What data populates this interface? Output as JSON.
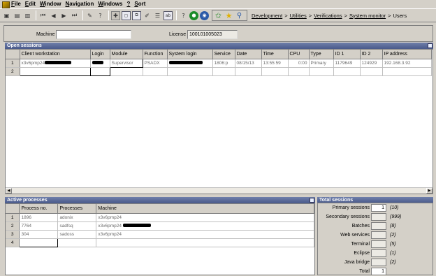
{
  "menu": {
    "items": [
      {
        "u": "F",
        "rest": "ile"
      },
      {
        "u": "E",
        "rest": "dit"
      },
      {
        "u": "W",
        "rest": "indow"
      },
      {
        "u": "N",
        "rest": "avigation"
      },
      {
        "u": "W",
        "rest": "indows"
      },
      {
        "u": "?",
        "rest": ""
      },
      {
        "u": "S",
        "rest": "ort"
      }
    ]
  },
  "breadcrumb": {
    "items": [
      "Development",
      "Utilities",
      "Verifications",
      "System monitor"
    ],
    "current": "Users",
    "separator": ">"
  },
  "filter": {
    "machine_label": "Machine",
    "machine_value": "",
    "license_label": "License",
    "license_value": "100101005023"
  },
  "open_sessions": {
    "title": "Open sessions",
    "columns": [
      "",
      "Client workstation",
      "Login",
      "Module",
      "Function",
      "System login",
      "Service",
      "Date",
      "Time",
      "CPU",
      "Type",
      "ID 1",
      "ID 2",
      "IP address"
    ],
    "rows": [
      {
        "num": "1",
        "client": "x3v6pmp24",
        "login": "",
        "module": "Supervisor",
        "function": "PSADX",
        "system_login": "",
        "service": "1806:p",
        "date": "08/15/13",
        "time": "13:55:59",
        "cpu": "0:00",
        "type": "Primary",
        "id1": "1179649",
        "id2": "124929",
        "ip": "192.168.3.92"
      },
      {
        "num": "2",
        "client": "",
        "login": "",
        "module": "",
        "function": "",
        "system_login": "",
        "service": "",
        "date": "",
        "time": "",
        "cpu": "",
        "type": "",
        "id1": "",
        "id2": "",
        "ip": ""
      }
    ]
  },
  "active_processes": {
    "title": "Active processes",
    "columns": [
      "",
      "Process no.",
      "Processes",
      "Machine"
    ],
    "rows": [
      {
        "num": "1",
        "process_no": "1896",
        "process": "adonix",
        "machine": "x3v6pmp24"
      },
      {
        "num": "2",
        "process_no": "7764",
        "process": "sadfsq",
        "machine": "x3v6pmp24"
      },
      {
        "num": "3",
        "process_no": "304",
        "process": "sadoss",
        "machine": "x3v6pmp24"
      },
      {
        "num": "4",
        "process_no": "",
        "process": "",
        "machine": ""
      }
    ]
  },
  "total_sessions": {
    "title": "Total sessions",
    "rows": [
      {
        "label": "Primary sessions",
        "value": "1",
        "max": "(10)"
      },
      {
        "label": "Secondary sessions",
        "value": "",
        "max": "(999)"
      },
      {
        "label": "Batches",
        "value": "",
        "max": "(8)"
      },
      {
        "label": "Web services",
        "value": "",
        "max": "(2)"
      },
      {
        "label": "Terminal",
        "value": "",
        "max": "(5)"
      },
      {
        "label": "Eclipse",
        "value": "",
        "max": "(1)"
      },
      {
        "label": "Java bridge",
        "value": "",
        "max": "(2)"
      },
      {
        "label": "Total",
        "value": "1",
        "max": ""
      }
    ]
  },
  "colors": {
    "header_gradient_top": "#6f7faa",
    "header_gradient_bottom": "#4a5a8a",
    "window_bg": "#d4d0c8"
  }
}
